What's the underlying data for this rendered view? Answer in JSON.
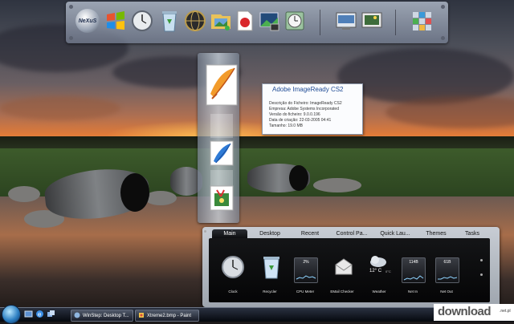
{
  "top_dock": {
    "items": [
      "nexus-logo",
      "windows-flag-icon",
      "clock-icon",
      "recycle-bin-icon",
      "globe-icon",
      "pictures-icon",
      "adobe-reader-icon",
      "screenshot-icon",
      "clock-settings-icon",
      "control-panel-icon",
      "picture-viewer-icon",
      "dock-settings-icon"
    ],
    "nexus_label": "NeXuS"
  },
  "tooltip": {
    "title": "Adobe ImageReady CS2",
    "lines": [
      "Descrição do Ficheiro: ImageReady CS2",
      "Empresa: Adobe Systems Incorporated",
      "Versão do ficheiro: 9.0.0.196",
      "Data de criação: 22-03-2005 04:41",
      "Tamanho: 19.0 MB"
    ]
  },
  "vertical_dock": {
    "items": [
      "imageready-icon",
      "blank-slot",
      "illustrator-icon",
      "blank-slot",
      "pi-program-icon"
    ]
  },
  "gadget_panel": {
    "tabs": [
      "Main",
      "Desktop",
      "Recent",
      "Control Pa...",
      "Quick Lau...",
      "Themes",
      "Tasks"
    ],
    "active_tab": "Main",
    "gadgets": [
      {
        "label": "Clock",
        "icon": "clock-icon"
      },
      {
        "label": "Recycler",
        "icon": "recycle-bin-icon"
      },
      {
        "label": "CPU Meter",
        "icon": "cpu-meter-icon",
        "value": "2%"
      },
      {
        "label": "EMail Checker",
        "icon": "email-icon"
      },
      {
        "label": "Weather",
        "icon": "weather-icon",
        "value": "12° C",
        "sub": "0°C"
      },
      {
        "label": "Net In",
        "icon": "net-in-icon",
        "value": "114B"
      },
      {
        "label": "Net Out",
        "icon": "net-out-icon",
        "value": "61B"
      }
    ]
  },
  "taskbar": {
    "quick_launch": [
      "show-desktop-icon",
      "internet-explorer-icon",
      "switch-windows-icon"
    ],
    "buttons": [
      {
        "label": "WinStep: Desktop T...",
        "icon": "winstep-icon"
      },
      {
        "label": "Xtreme2.bmp - Paint",
        "icon": "paint-icon"
      }
    ]
  },
  "watermark": {
    "brand": "download",
    "suffix": ".net.pl"
  },
  "colors": {
    "tooltip_title": "#1f4b95",
    "tab_active_bg": "#0d0e10",
    "taskbar_bg": "#05080d",
    "start_orb": "#2d7fc2"
  }
}
